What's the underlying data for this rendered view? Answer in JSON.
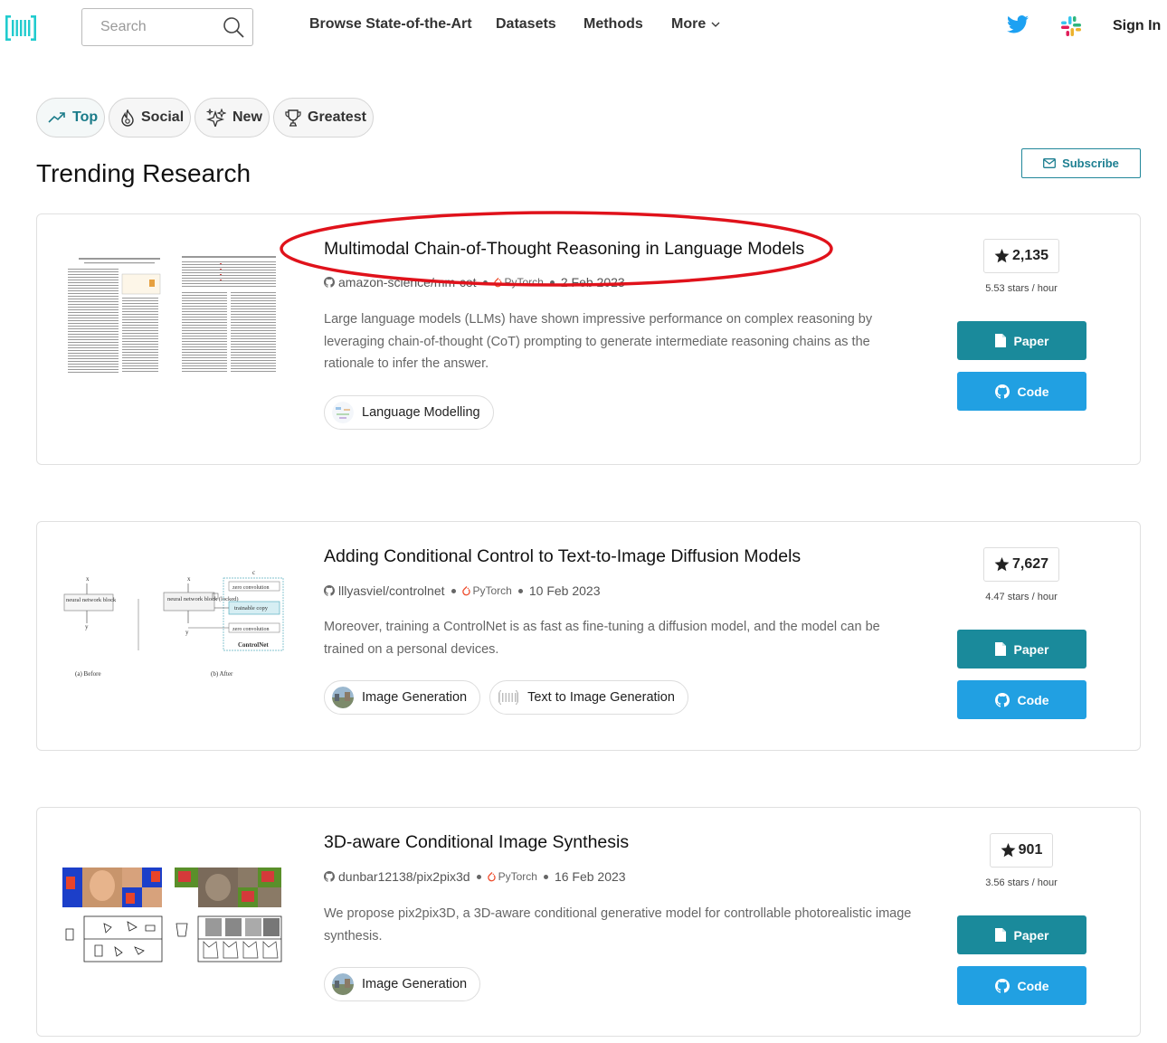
{
  "header": {
    "logo": "paperswithcode-logo",
    "search_placeholder": "Search",
    "nav": [
      "Browse State-of-the-Art",
      "Datasets",
      "Methods",
      "More"
    ],
    "sign_in": "Sign In"
  },
  "filters": [
    {
      "label": "Top",
      "icon": "trending-icon",
      "active": true
    },
    {
      "label": "Social",
      "icon": "flame-icon",
      "active": false
    },
    {
      "label": "New",
      "icon": "sparkle-icon",
      "active": false
    },
    {
      "label": "Greatest",
      "icon": "trophy-icon",
      "active": false
    }
  ],
  "page_title": "Trending Research",
  "subscribe_label": "Subscribe",
  "papers": [
    {
      "title": "Multimodal Chain-of-Thought Reasoning in Language Models",
      "repo": "amazon-science/mm-cot",
      "framework": "PyTorch",
      "date": "2 Feb 2023",
      "abstract": "Large language models (LLMs) have shown impressive performance on complex reasoning by leveraging chain-of-thought (CoT) prompting to generate intermediate reasoning chains as the rationale to infer the answer.",
      "tags": [
        "Language Modelling"
      ],
      "stars": "2,135",
      "rate": "5.53 stars / hour",
      "highlighted": true
    },
    {
      "title": "Adding Conditional Control to Text-to-Image Diffusion Models",
      "repo": "lllyasviel/controlnet",
      "framework": "PyTorch",
      "date": "10 Feb 2023",
      "abstract": "Moreover, training a ControlNet is as fast as fine-tuning a diffusion model, and the model can be trained on a personal devices.",
      "tags": [
        "Image Generation",
        "Text to Image Generation"
      ],
      "stars": "7,627",
      "rate": "4.47 stars / hour",
      "figure_labels": {
        "block": "neural network block",
        "block_locked": "neural network block (locked)",
        "zero_conv": "zero convolution",
        "trainable": "trainable copy",
        "controlnet": "ControlNet",
        "before": "(a) Before",
        "after": "(b) After",
        "x": "x",
        "y": "y",
        "c": "c",
        "yc": "y_c"
      }
    },
    {
      "title": "3D-aware Conditional Image Synthesis",
      "repo": "dunbar12138/pix2pix3d",
      "framework": "PyTorch",
      "date": "16 Feb 2023",
      "abstract": "We propose pix2pix3D, a 3D-aware conditional generative model for controllable photorealistic image synthesis.",
      "tags": [
        "Image Generation"
      ],
      "stars": "901",
      "rate": "3.56 stars / hour"
    }
  ],
  "buttons": {
    "paper": "Paper",
    "code": "Code"
  },
  "colors": {
    "brand": "#21cbce",
    "paper_button": "#1a8a9b",
    "code_button": "#21a0e2",
    "highlight": "#e0121b"
  }
}
